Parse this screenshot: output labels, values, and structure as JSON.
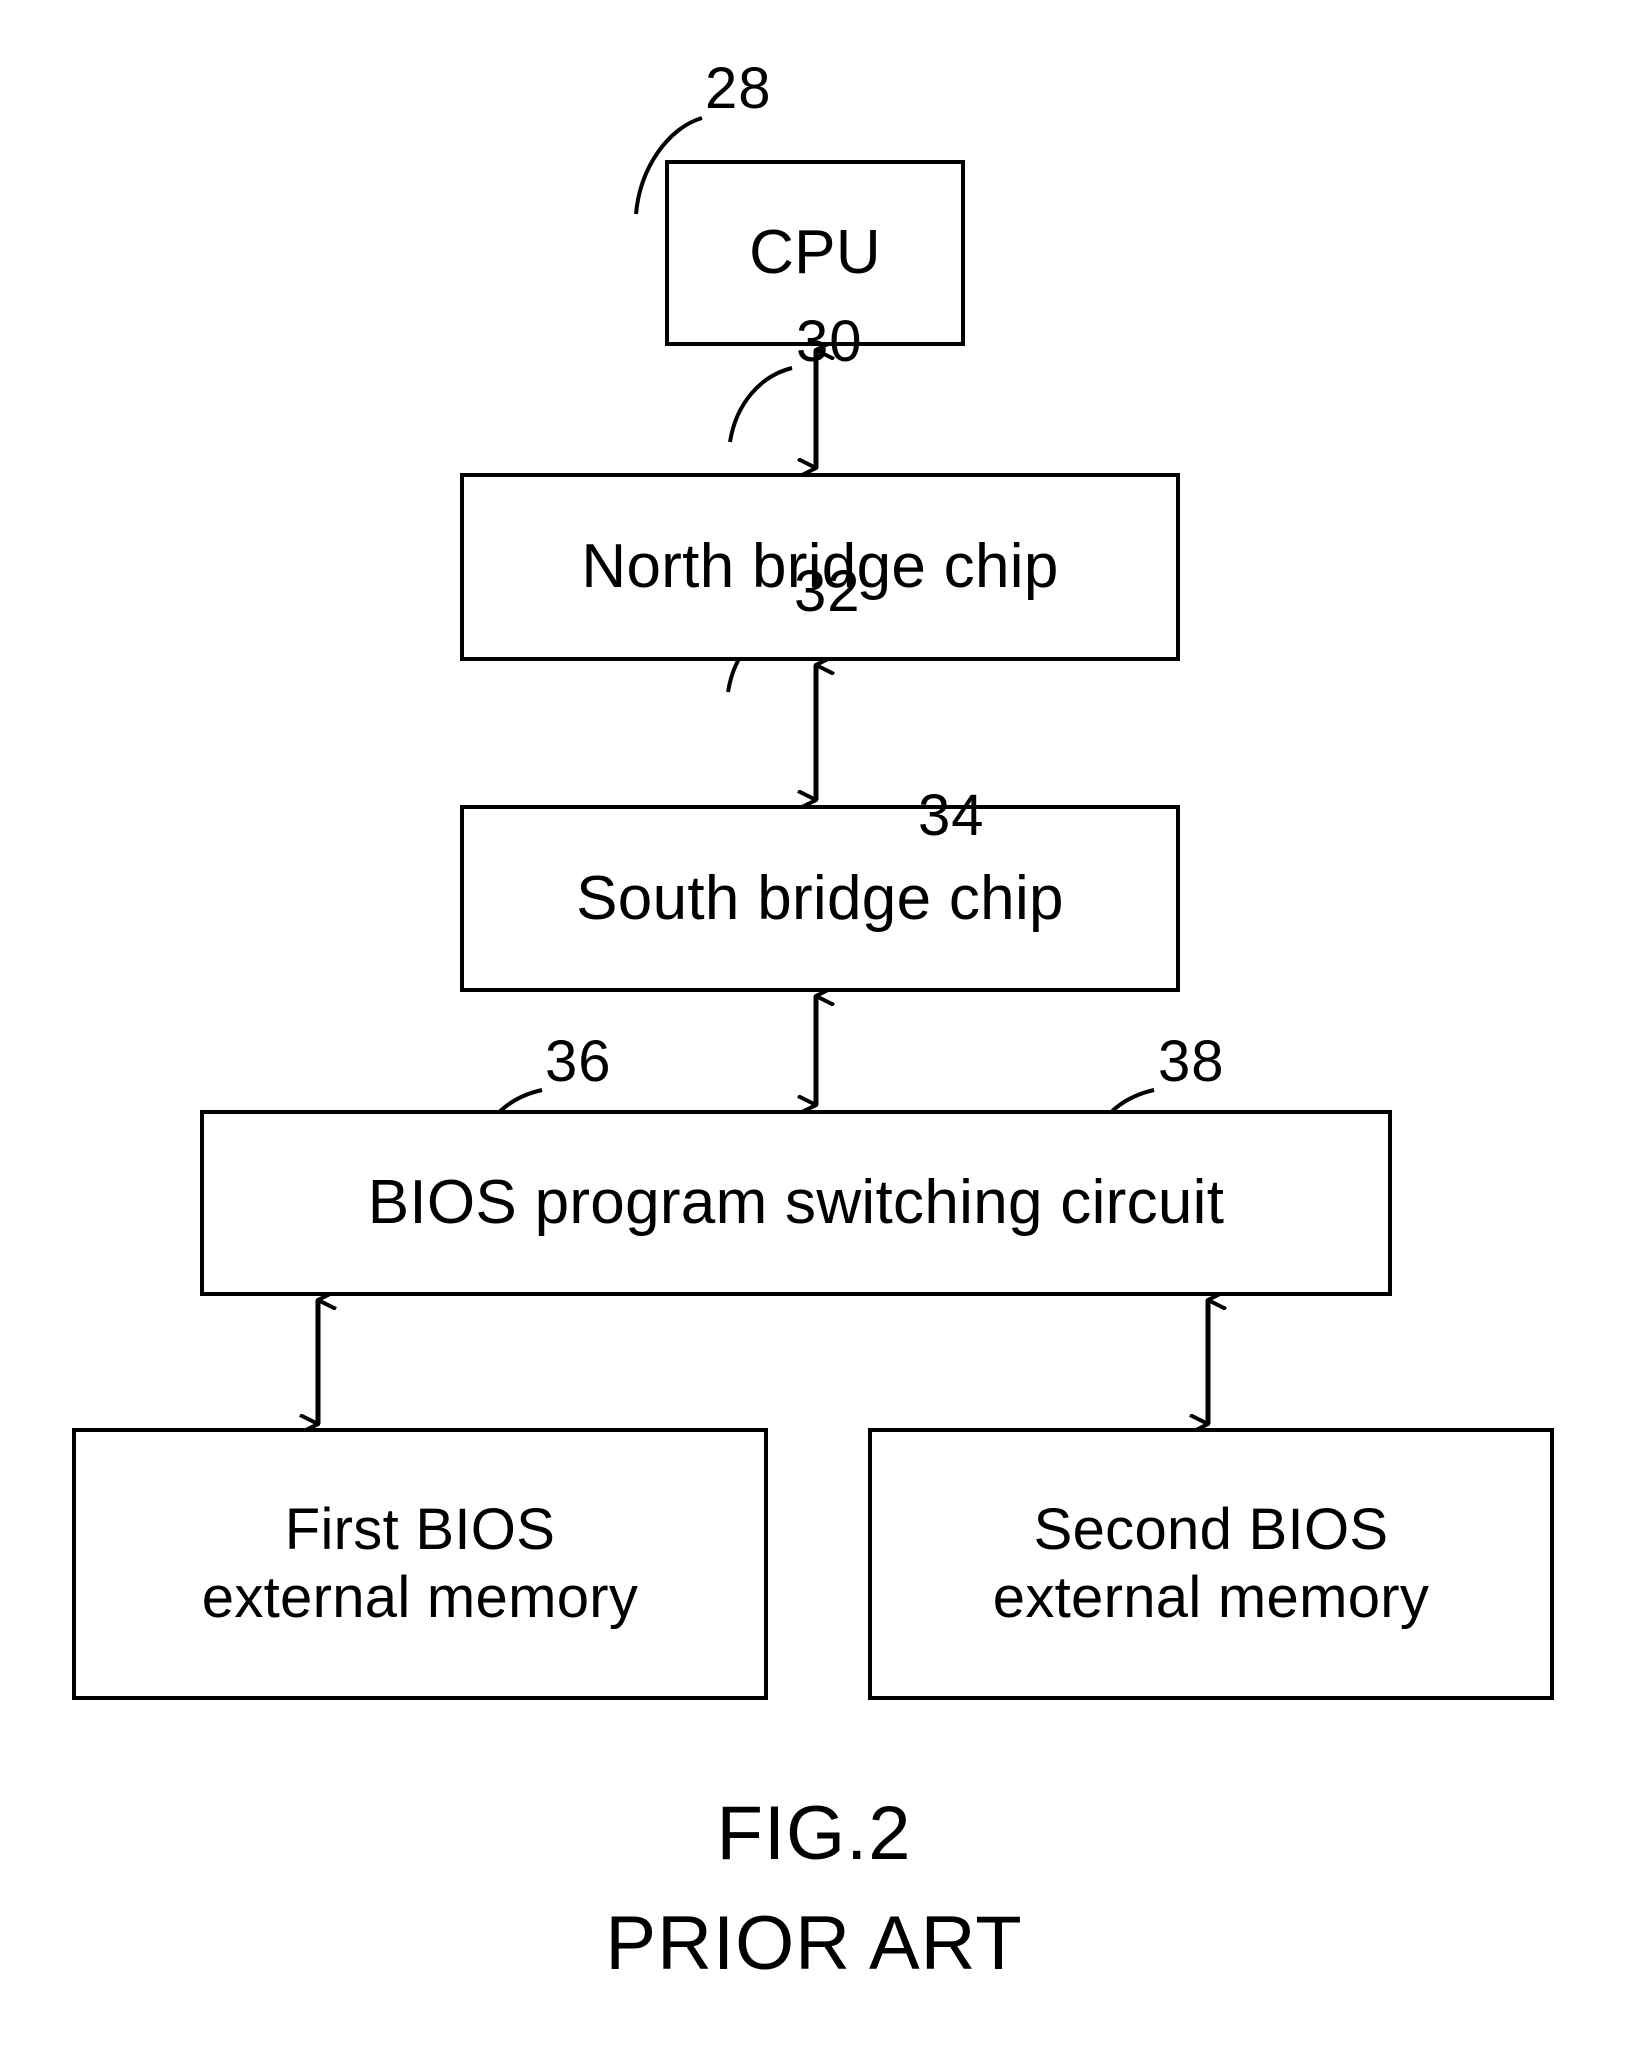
{
  "figure": {
    "caption_main": "FIG.2",
    "caption_sub": "PRIOR ART"
  },
  "blocks": [
    {
      "id": "cpu",
      "label": "CPU",
      "ref": "28"
    },
    {
      "id": "north",
      "label": "North bridge chip",
      "ref": "30"
    },
    {
      "id": "south",
      "label": "South bridge chip",
      "ref": "32"
    },
    {
      "id": "switch",
      "label": "BIOS program switching circuit",
      "ref": "34"
    },
    {
      "id": "first",
      "label": "First BIOS\nexternal memory",
      "ref": "36"
    },
    {
      "id": "second",
      "label": "Second BIOS\nexternal memory",
      "ref": "38"
    }
  ],
  "connections": [
    {
      "from": "north",
      "to": "cpu",
      "style": "double-headed-arrow"
    },
    {
      "from": "south",
      "to": "north",
      "style": "double-headed-arrow"
    },
    {
      "from": "switch",
      "to": "south",
      "style": "double-headed-arrow"
    },
    {
      "from": "first",
      "to": "switch",
      "style": "double-headed-arrow"
    },
    {
      "from": "second",
      "to": "switch",
      "style": "double-headed-arrow"
    }
  ],
  "colors": {
    "line": "#000000",
    "background": "#ffffff",
    "text": "#000000"
  }
}
